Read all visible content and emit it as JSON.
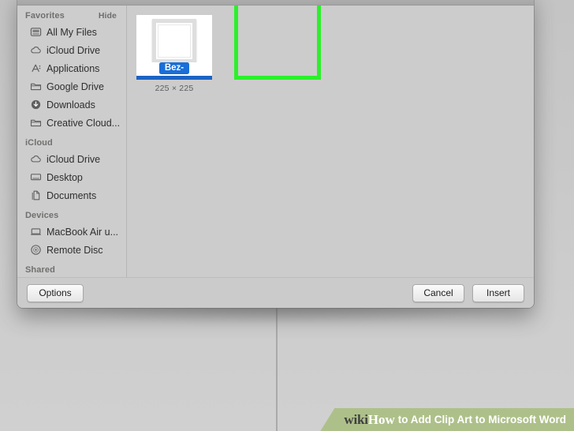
{
  "dialog": {
    "sidebar": {
      "sections": [
        {
          "title": "Favorites",
          "hide_label": "Hide",
          "items": [
            {
              "label": "All My Files",
              "icon": "all-my-files-icon"
            },
            {
              "label": "iCloud Drive",
              "icon": "cloud-icon"
            },
            {
              "label": "Applications",
              "icon": "applications-icon"
            },
            {
              "label": "Google Drive",
              "icon": "folder-icon"
            },
            {
              "label": "Downloads",
              "icon": "downloads-icon"
            },
            {
              "label": "Creative Cloud...",
              "icon": "folder-icon"
            }
          ]
        },
        {
          "title": "iCloud",
          "hide_label": "",
          "items": [
            {
              "label": "iCloud Drive",
              "icon": "cloud-icon"
            },
            {
              "label": "Desktop",
              "icon": "desktop-icon"
            },
            {
              "label": "Documents",
              "icon": "documents-icon"
            }
          ]
        },
        {
          "title": "Devices",
          "hide_label": "",
          "items": [
            {
              "label": "MacBook Air u...",
              "icon": "laptop-icon"
            },
            {
              "label": "Remote Disc",
              "icon": "disc-icon"
            }
          ]
        },
        {
          "title": "Shared",
          "hide_label": "",
          "items": []
        }
      ]
    },
    "browser": {
      "files": [
        {
          "name": "Bez-",
          "dimensions": "225 × 225",
          "selected": true,
          "thumbnail": "blank-image-thumbnail"
        }
      ]
    },
    "footer": {
      "options_label": "Options",
      "cancel_label": "Cancel",
      "insert_label": "Insert"
    }
  },
  "annotation": {
    "highlight_color": "#2bf02b"
  },
  "watermark": {
    "wiki": "wiki",
    "how": "How",
    "rest": "to Add Clip Art to Microsoft Word"
  },
  "colors": {
    "selection_blue": "#1a6ed8",
    "dialog_bg": "#cfcfcf",
    "sidebar_bg": "#cdcdcd",
    "watermark_bg": "#aec08a"
  }
}
